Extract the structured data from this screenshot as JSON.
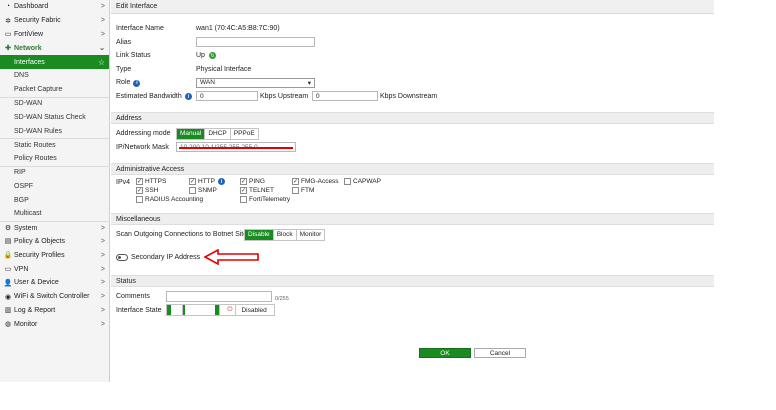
{
  "sidebar": {
    "items": [
      {
        "label": "Dashboard",
        "icon": "dashboard-icon",
        "glyph": "◔",
        "chevron": ">"
      },
      {
        "label": "Security Fabric",
        "icon": "security-fabric-icon",
        "glyph": "✲",
        "chevron": ">"
      },
      {
        "label": "FortiView",
        "icon": "fortiview-icon",
        "glyph": "▭",
        "chevron": ">"
      },
      {
        "label": "Network",
        "icon": "network-icon",
        "glyph": "✚",
        "chevron": "⌄"
      }
    ],
    "network_sub": [
      "Interfaces",
      "DNS",
      "Packet Capture",
      "SD-WAN",
      "SD-WAN Status Check",
      "SD-WAN Rules",
      "Static Routes",
      "Policy Routes",
      "RIP",
      "OSPF",
      "BGP",
      "Multicast"
    ],
    "bottom_items": [
      {
        "label": "System",
        "icon": "system-icon",
        "glyph": "⚙",
        "chevron": ">"
      },
      {
        "label": "Policy & Objects",
        "icon": "policy-objects-icon",
        "glyph": "▤",
        "chevron": ">"
      },
      {
        "label": "Security Profiles",
        "icon": "security-profiles-icon",
        "glyph": "🔒",
        "chevron": ">"
      },
      {
        "label": "VPN",
        "icon": "vpn-icon",
        "glyph": "▭",
        "chevron": ">"
      },
      {
        "label": "User & Device",
        "icon": "user-device-icon",
        "glyph": "👤",
        "chevron": ">"
      },
      {
        "label": "WiFi & Switch Controller",
        "icon": "wifi-switch-icon",
        "glyph": "◉",
        "chevron": ">"
      },
      {
        "label": "Log & Report",
        "icon": "log-report-icon",
        "glyph": "▥",
        "chevron": ">"
      },
      {
        "label": "Monitor",
        "icon": "monitor-icon",
        "glyph": "◍",
        "chevron": ">"
      }
    ],
    "active_star": "☆"
  },
  "main": {
    "title": "Edit Interface",
    "general": {
      "interface_name_label": "Interface Name",
      "interface_name_value": "wan1 (70:4C:A5:B8:7C:90)",
      "alias_label": "Alias",
      "alias_value": "",
      "link_status_label": "Link Status",
      "link_status_value": "Up",
      "type_label": "Type",
      "type_value": "Physical Interface",
      "role_label": "Role",
      "role_value": "WAN",
      "bandwidth_label": "Estimated Bandwidth",
      "upstream_value": "0",
      "upstream_label": "Kbps Upstream",
      "downstream_value": "0",
      "downstream_label": "Kbps Downstream"
    },
    "address": {
      "header": "Address",
      "mode_label": "Addressing mode",
      "modes": [
        "Manual",
        "DHCP",
        "PPPoE"
      ],
      "active_mode": "Manual",
      "ip_label": "IP/Network Mask",
      "ip_value": "10.200.10.1/255.255.255.0"
    },
    "admin_access": {
      "header": "Administrative Access",
      "ipv4_label": "IPv4",
      "options": [
        {
          "label": "HTTPS",
          "checked": true
        },
        {
          "label": "HTTP",
          "checked": true,
          "info": true
        },
        {
          "label": "PING",
          "checked": true
        },
        {
          "label": "FMG-Access",
          "checked": true
        },
        {
          "label": "CAPWAP",
          "checked": false
        },
        {
          "label": "SSH",
          "checked": true
        },
        {
          "label": "SNMP",
          "checked": false
        },
        {
          "label": "TELNET",
          "checked": true
        },
        {
          "label": "FTM",
          "checked": false
        },
        {
          "label": "RADIUS Accounting",
          "checked": false
        },
        {
          "label": "FortiTelemetry",
          "checked": false
        }
      ]
    },
    "misc": {
      "header": "Miscellaneous",
      "botnet_label": "Scan Outgoing Connections to Botnet Sites",
      "botnet_options": [
        "Disable",
        "Block",
        "Monitor"
      ],
      "botnet_active": "Disable",
      "secondary_ip_label": "Secondary IP Address"
    },
    "status": {
      "header": "Status",
      "comments_label": "Comments",
      "comments_value": "",
      "comments_count": "0/255",
      "state_label": "Interface State",
      "enabled_label": "Enabled",
      "disabled_label": "Disabled"
    },
    "buttons": {
      "ok": "OK",
      "cancel": "Cancel"
    }
  },
  "colors": {
    "accent": "#1a8b20",
    "annotation_red": "#e30000",
    "info_blue": "#1e63b5"
  }
}
